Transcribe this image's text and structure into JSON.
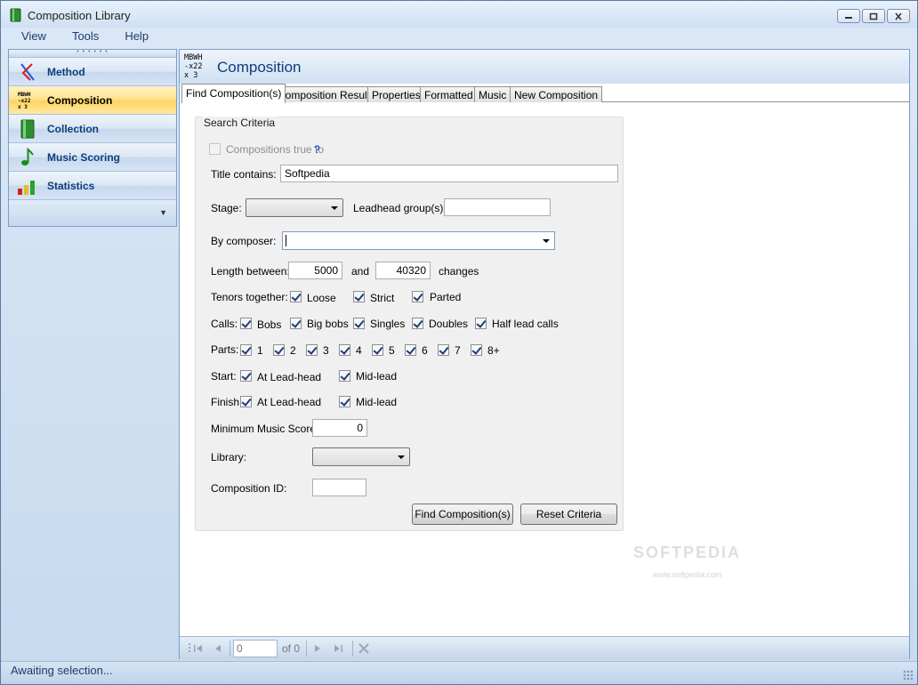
{
  "window": {
    "title": "Composition Library"
  },
  "menu": [
    "View",
    "Tools",
    "Help"
  ],
  "nav": {
    "items": [
      {
        "label": "Method",
        "icon": "method-icon",
        "active": false
      },
      {
        "label": "Composition",
        "icon": "composition-icon",
        "active": true
      },
      {
        "label": "Collection",
        "icon": "book-icon",
        "active": false
      },
      {
        "label": "Music Scoring",
        "icon": "music-note-icon",
        "active": false
      },
      {
        "label": "Statistics",
        "icon": "bar-chart-icon",
        "active": false
      }
    ]
  },
  "header": {
    "icon_text": [
      "MBWH",
      "-x22",
      "x 3"
    ],
    "title": "Composition"
  },
  "tabs": [
    "Find Composition(s)",
    "Composition Results",
    "Properties",
    "Formatted",
    "Music",
    "New Composition"
  ],
  "search": {
    "legend": "Search Criteria",
    "true_to_label": "Compositions true to",
    "help_mark": "?",
    "title_label": "Title contains:",
    "title_value": "Softpedia",
    "stage_label": "Stage:",
    "stage_value": "",
    "leadhead_label": "Leadhead group(s):",
    "leadhead_value": "",
    "composer_label": "By composer:",
    "composer_value": "",
    "length_label": "Length between:",
    "length_min": "5000",
    "length_and": "and",
    "length_max": "40320",
    "length_unit": "changes",
    "tenors_label": "Tenors together:",
    "tenors": [
      {
        "label": "Loose",
        "checked": true
      },
      {
        "label": "Strict",
        "checked": true
      },
      {
        "label": "Parted",
        "checked": true
      }
    ],
    "calls_label": "Calls:",
    "calls": [
      {
        "label": "Bobs",
        "checked": true
      },
      {
        "label": "Big bobs",
        "checked": true
      },
      {
        "label": "Singles",
        "checked": true
      },
      {
        "label": "Doubles",
        "checked": true
      },
      {
        "label": "Half lead calls",
        "checked": true
      }
    ],
    "parts_label": "Parts:",
    "parts": [
      "1",
      "2",
      "3",
      "4",
      "5",
      "6",
      "7",
      "8+"
    ],
    "start_label": "Start:",
    "start": [
      {
        "label": "At Lead-head",
        "checked": true
      },
      {
        "label": "Mid-lead",
        "checked": true
      }
    ],
    "finish_label": "Finish:",
    "finish": [
      {
        "label": "At Lead-head",
        "checked": true
      },
      {
        "label": "Mid-lead",
        "checked": true
      }
    ],
    "music_label": "Minimum Music Score:",
    "music_value": "0",
    "library_label": "Library:",
    "library_value": "",
    "id_label": "Composition ID:",
    "id_value": "",
    "find_button": "Find Composition(s)",
    "reset_button": "Reset Criteria"
  },
  "navigator": {
    "position_placeholder": "0",
    "of_text": "of 0"
  },
  "status": {
    "text": "Awaiting selection..."
  },
  "watermark": {
    "text": "SOFTPEDIA",
    "sub": "www.softpedia.com"
  },
  "colors": {
    "accent": "#0f3d7a",
    "active_nav": "#ffd35c",
    "check": "#1c3b7a"
  }
}
